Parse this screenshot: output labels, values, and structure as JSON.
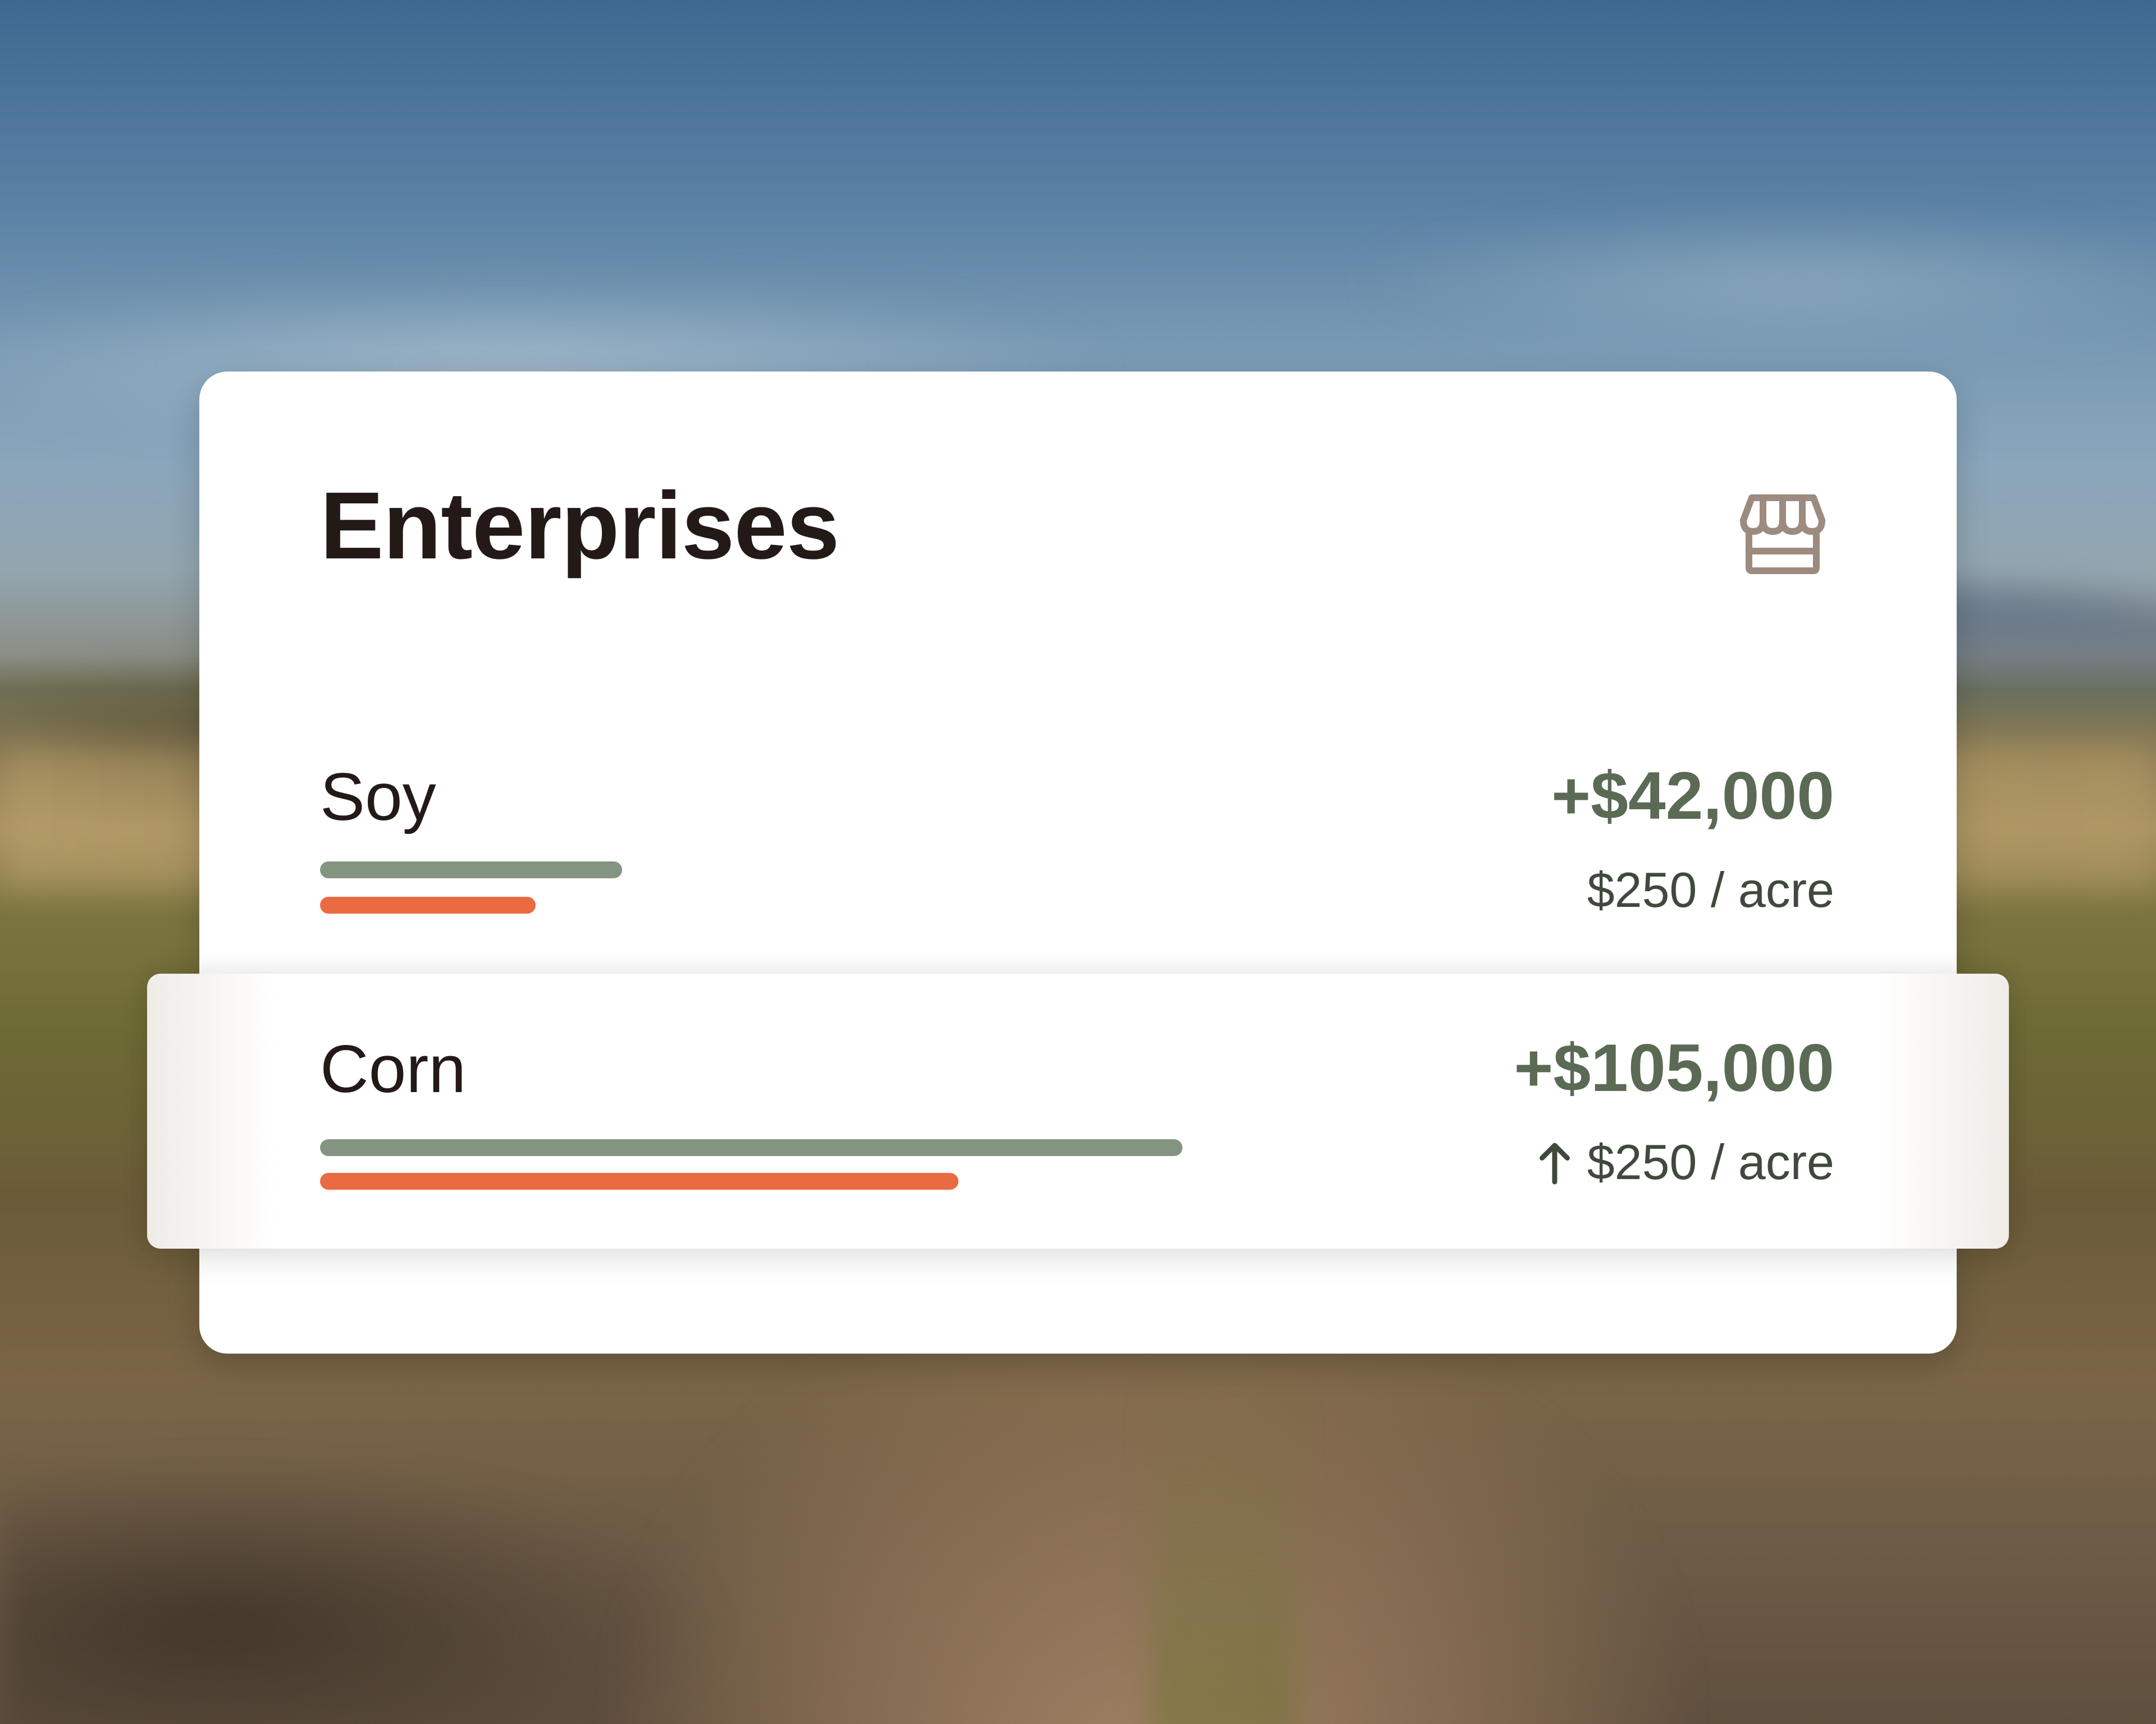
{
  "card": {
    "title": "Enterprises",
    "icon": "storefront-icon"
  },
  "enterprises": [
    {
      "name": "Soy",
      "amount": "+$42,000",
      "rate": "$250 / acre",
      "trend_icon": null,
      "bars": {
        "primary_fraction": 0.35,
        "secondary_fraction": 0.25
      }
    },
    {
      "name": "Corn",
      "amount": "+$105,000",
      "rate": "$250 / acre",
      "trend_icon": "arrow-up-icon",
      "bars": {
        "primary_fraction": 1.0,
        "secondary_fraction": 0.74
      }
    }
  ],
  "colors": {
    "bar_primary": "#839581",
    "bar_secondary": "#ea6b42",
    "amount": "#5a6a55",
    "title": "#231a17",
    "icon": "#9c8b7e"
  }
}
